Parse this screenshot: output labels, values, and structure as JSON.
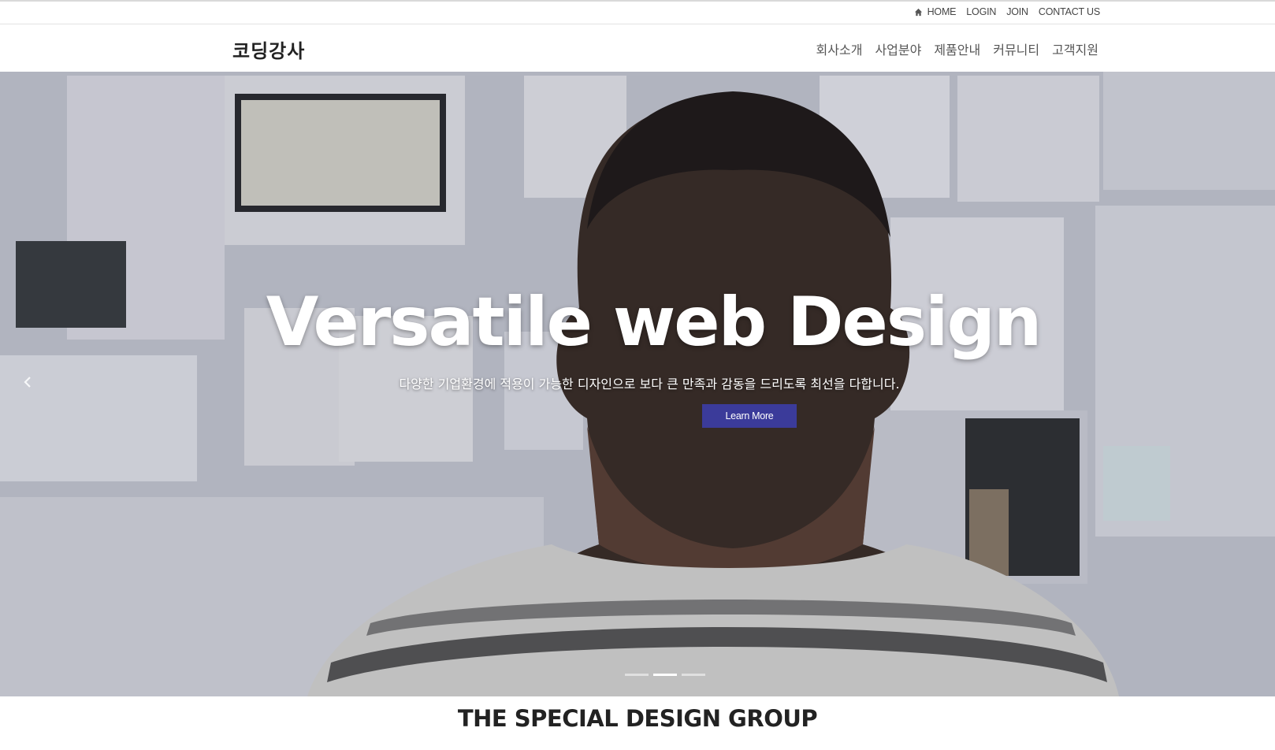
{
  "util_nav": {
    "home": "HOME",
    "login": "LOGIN",
    "join": "JOIN",
    "contact": "CONTACT US"
  },
  "header": {
    "logo": "코딩강사",
    "nav": [
      "회사소개",
      "사업분야",
      "제품안내",
      "커뮤니티",
      "고객지원"
    ]
  },
  "hero": {
    "title": "Versatile web Design",
    "subtitle": "다양한 기업환경에 적용이 가능한 디자인으로 보다 큰 만족과 감동을 드리도록 최선을 다합니다.",
    "button": "Learn More",
    "prev_icon": "chevron-left-icon",
    "slides": 3,
    "active_slide": 2,
    "accent_color": "#3b3b9a"
  },
  "section": {
    "title": "THE SPECIAL DESIGN GROUP"
  }
}
